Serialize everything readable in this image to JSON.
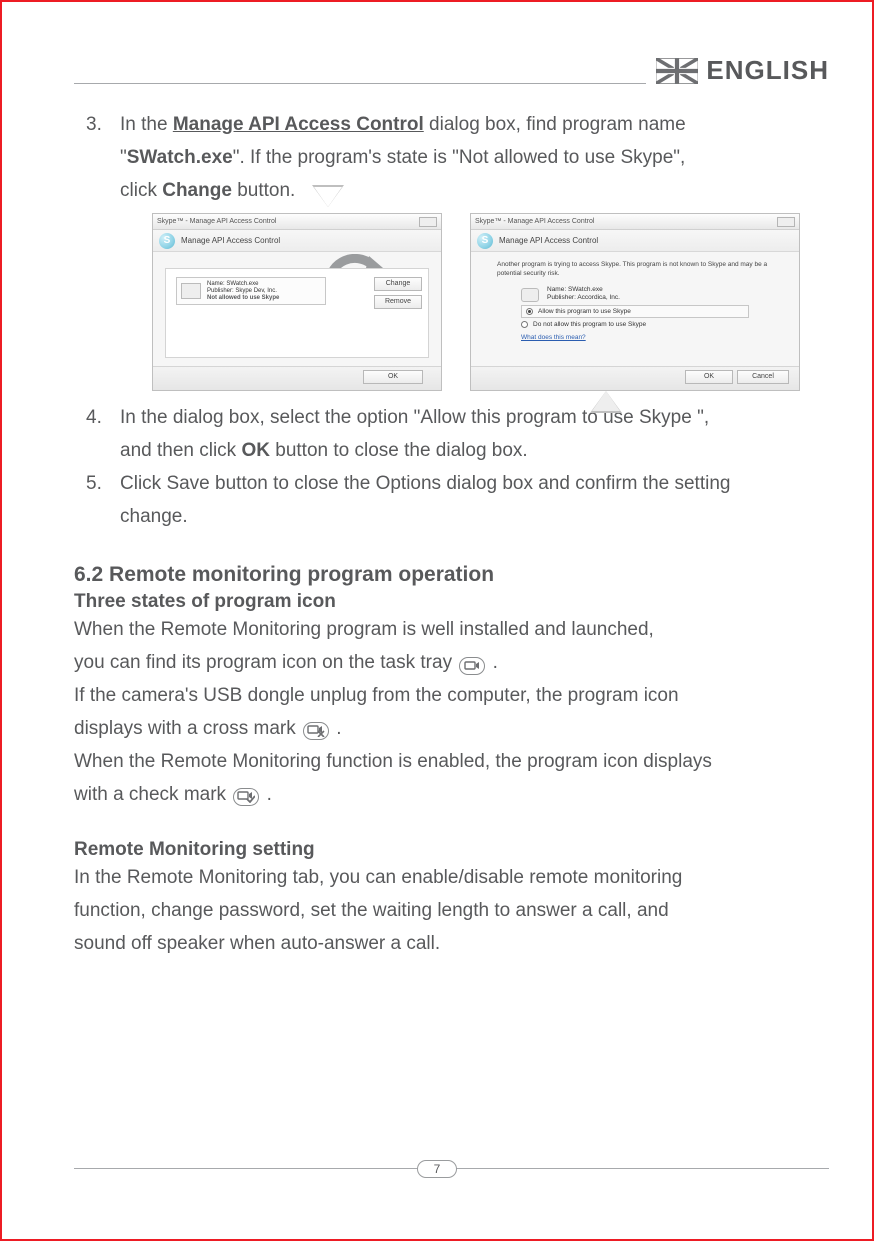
{
  "header": {
    "language": "ENGLISH"
  },
  "step3": {
    "num": "3.",
    "l1a": "In the ",
    "l1b": "Manage API Access Control",
    "l1c": " dialog box, find program name",
    "l2a": "\"",
    "l2b": "SWatch.exe",
    "l2c": "\". If the program's state is \"Not allowed to use Skype\",",
    "l3a": "click ",
    "l3b": "Change",
    "l3c": " button."
  },
  "shotA": {
    "title": "Skype™ - Manage API Access Control",
    "header": "Manage API Access Control",
    "row_name": "Name: SWatch.exe",
    "row_pub": "Publisher: Skype Dev, Inc.",
    "row_state": "Not allowed to use Skype",
    "btn_change": "Change",
    "btn_remove": "Remove",
    "btn_ok": "OK"
  },
  "shotB": {
    "title": "Skype™ - Manage API Access Control",
    "header": "Manage API Access Control",
    "msg": "Another program is trying to access Skype. This program is not known to Skype and may be a potential security risk.",
    "name": "Name: SWatch.exe",
    "pub": "Publisher: Accordica, Inc.",
    "opt_allow": "Allow this program to use Skype",
    "opt_deny": "Do not allow this program to use Skype",
    "link": "What does this mean?",
    "btn_ok": "OK",
    "btn_cancel": "Cancel"
  },
  "step4": {
    "num": "4.",
    "l1": "In the dialog box, select the option \"Allow this program to use Skype \",",
    "l2a": "and then click ",
    "l2b": "OK",
    "l2c": " button to close the dialog box."
  },
  "step5": {
    "num": "5.",
    "l1": "Click Save button to close the Options dialog box and confirm the setting",
    "l2": "change."
  },
  "sec62": {
    "title": "6.2 Remote monitoring program operation",
    "sub1": "Three states of program icon",
    "p1": "When the Remote Monitoring program is well installed and launched,",
    "p2a": "you can find its program icon on the task tray ",
    "p2b": " .",
    "p3": "If the camera's USB dongle unplug from the computer, the program icon",
    "p4a": "displays with a cross mark ",
    "p4b": " .",
    "p5": "When the Remote Monitoring function is enabled, the program icon displays",
    "p6a": "with a check mark ",
    "p6b": " .",
    "sub2": "Remote Monitoring setting",
    "q1": "In the Remote Monitoring tab, you can enable/disable remote monitoring",
    "q2": "function, change password, set the waiting length to answer a call, and",
    "q3": "sound off speaker when auto-answer a call."
  },
  "page_number": "7"
}
